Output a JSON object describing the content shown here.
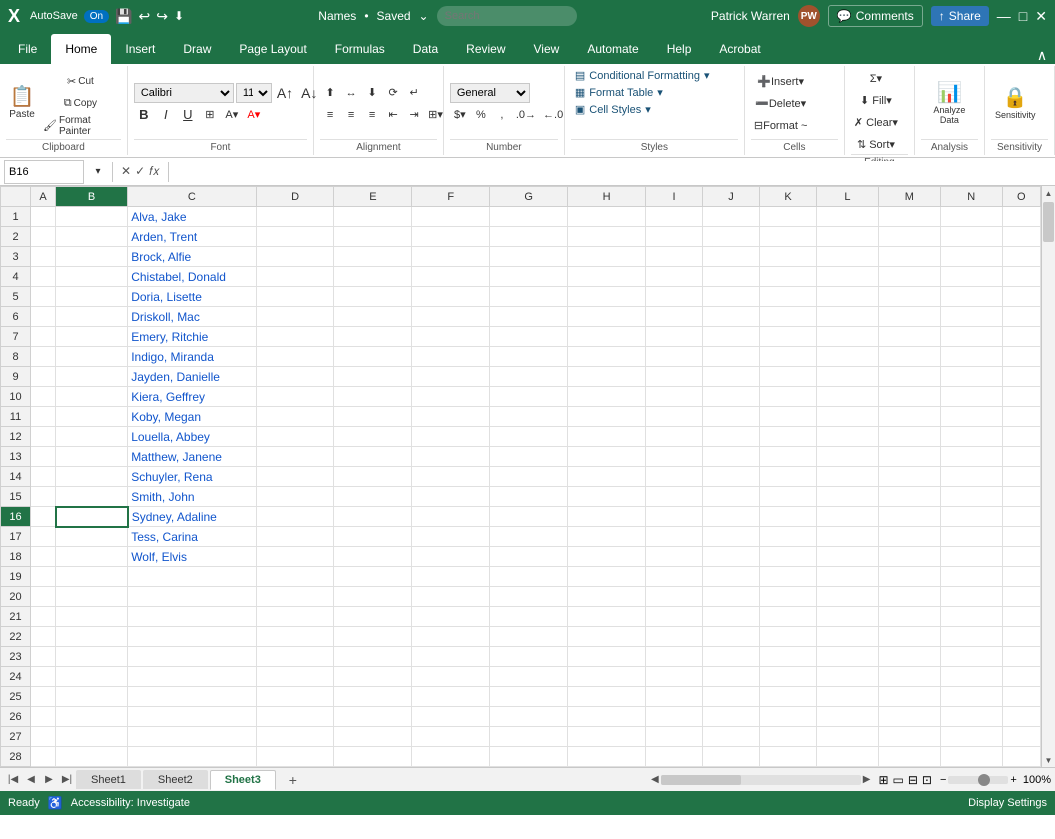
{
  "titleBar": {
    "autosave": "AutoSave",
    "autosaveState": "On",
    "fileName": "Names",
    "savedState": "Saved",
    "searchPlaceholder": "Search",
    "userName": "Patrick Warren",
    "userInitials": "PW"
  },
  "ribbonTabs": {
    "tabs": [
      "File",
      "Home",
      "Insert",
      "Draw",
      "Page Layout",
      "Formulas",
      "Data",
      "Review",
      "View",
      "Automate",
      "Help",
      "Acrobat"
    ],
    "activeTab": "Home"
  },
  "ribbon": {
    "clipboard": {
      "label": "Clipboard",
      "paste": "Paste",
      "cut": "Cut",
      "copy": "Copy",
      "formatPainter": "Format Painter"
    },
    "font": {
      "label": "Font",
      "fontName": "Calibri",
      "fontSize": "11",
      "bold": "B",
      "italic": "I",
      "underline": "U",
      "bold2": "B",
      "italic2": "I"
    },
    "alignment": {
      "label": "Alignment"
    },
    "number": {
      "label": "Number",
      "format": "General"
    },
    "styles": {
      "label": "Styles",
      "conditionalFormatting": "Conditional Formatting",
      "formatTable": "Format Table",
      "cellStyles": "Cell Styles"
    },
    "cells": {
      "label": "Cells",
      "insert": "Insert",
      "delete": "Delete",
      "format": "Format ~"
    },
    "editing": {
      "label": "Editing"
    },
    "analysis": {
      "label": "Analysis",
      "analyzeData": "Analyze Data"
    },
    "sensitivity": {
      "label": "Sensitivity",
      "sensitivity": "Sensitivity"
    }
  },
  "formulaBar": {
    "nameBox": "B16",
    "formula": ""
  },
  "grid": {
    "columns": [
      "A",
      "B",
      "C",
      "D",
      "E",
      "F",
      "G",
      "H",
      "I",
      "J",
      "K",
      "L",
      "M",
      "N",
      "O"
    ],
    "rows": 28,
    "activeCell": {
      "row": 16,
      "col": 2
    },
    "data": {
      "C1": "Alva, Jake",
      "C2": "Arden, Trent",
      "C3": "Brock, Alfie",
      "C4": "Chistabel, Donald",
      "C5": "Doria, Lisette",
      "C6": "Driskoll, Mac",
      "C7": "Emery, Ritchie",
      "C8": "Indigo, Miranda",
      "C9": "Jayden, Danielle",
      "C10": "Kiera, Geffrey",
      "C11": "Koby, Megan",
      "C12": "Louella, Abbey",
      "C13": "Matthew, Janene",
      "C14": "Schuyler, Rena",
      "C15": "Smith, John",
      "C16": "Sydney, Adaline",
      "C17": "Tess, Carina",
      "C18": "Wolf, Elvis"
    }
  },
  "sheetTabs": {
    "sheets": [
      "Sheet1",
      "Sheet2",
      "Sheet3"
    ],
    "activeSheet": "Sheet3"
  },
  "statusBar": {
    "status": "Ready",
    "accessibility": "Accessibility: Investigate",
    "displaySettings": "Display Settings"
  }
}
